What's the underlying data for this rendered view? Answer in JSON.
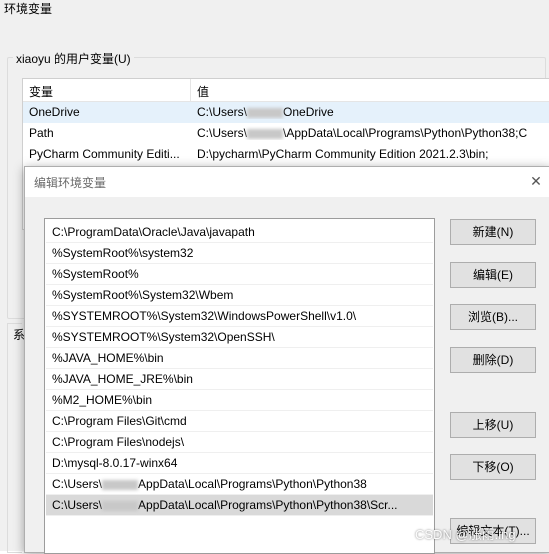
{
  "background_window": {
    "title": "环境变量",
    "user_group_label": "xiaoyu 的用户变量(U)",
    "system_group_label_partial": "系",
    "columns": [
      "变量",
      "值"
    ],
    "rows": [
      {
        "name": "OneDrive",
        "value_prefix": "C:\\Users\\",
        "value_suffix": "OneDrive"
      },
      {
        "name": "Path",
        "value_prefix": "C:\\Users\\",
        "value_suffix": "\\AppData\\Local\\Programs\\Python\\Python38;C"
      },
      {
        "name": "PyCharm Community Editi...",
        "value_prefix": "D:\\pycharm\\PyCharm Community Edition 2021.2.3\\bin;",
        "value_suffix": ""
      }
    ]
  },
  "dialog": {
    "title": "编辑环境变量",
    "close_label": "✕",
    "entries": [
      {
        "prefix": "C:\\ProgramData\\Oracle\\Java\\javapath",
        "suffix": "",
        "blurred": false
      },
      {
        "prefix": "%SystemRoot%\\system32",
        "suffix": "",
        "blurred": false
      },
      {
        "prefix": "%SystemRoot%",
        "suffix": "",
        "blurred": false
      },
      {
        "prefix": "%SystemRoot%\\System32\\Wbem",
        "suffix": "",
        "blurred": false
      },
      {
        "prefix": "%SYSTEMROOT%\\System32\\WindowsPowerShell\\v1.0\\",
        "suffix": "",
        "blurred": false
      },
      {
        "prefix": "%SYSTEMROOT%\\System32\\OpenSSH\\",
        "suffix": "",
        "blurred": false
      },
      {
        "prefix": "%JAVA_HOME%\\bin",
        "suffix": "",
        "blurred": false
      },
      {
        "prefix": "%JAVA_HOME_JRE%\\bin",
        "suffix": "",
        "blurred": false
      },
      {
        "prefix": "%M2_HOME%\\bin",
        "suffix": "",
        "blurred": false
      },
      {
        "prefix": "C:\\Program Files\\Git\\cmd",
        "suffix": "",
        "blurred": false
      },
      {
        "prefix": "C:\\Program Files\\nodejs\\",
        "suffix": "",
        "blurred": false
      },
      {
        "prefix": "D:\\mysql-8.0.17-winx64",
        "suffix": "",
        "blurred": false
      },
      {
        "prefix": "C:\\Users\\",
        "suffix": "AppData\\Local\\Programs\\Python\\Python38",
        "blurred": true
      },
      {
        "prefix": "C:\\Users\\",
        "suffix": "AppData\\Local\\Programs\\Python\\Python38\\Scr...",
        "blurred": true
      }
    ],
    "selected_index": 13,
    "buttons": {
      "new": "新建(N)",
      "edit": "编辑(E)",
      "browse": "浏览(B)...",
      "delete": "删除(D)",
      "move_up": "上移(U)",
      "move_down": "下移(O)",
      "edit_text": "编辑文本(T)..."
    }
  },
  "watermark": "CSDN @涨雨.ing"
}
